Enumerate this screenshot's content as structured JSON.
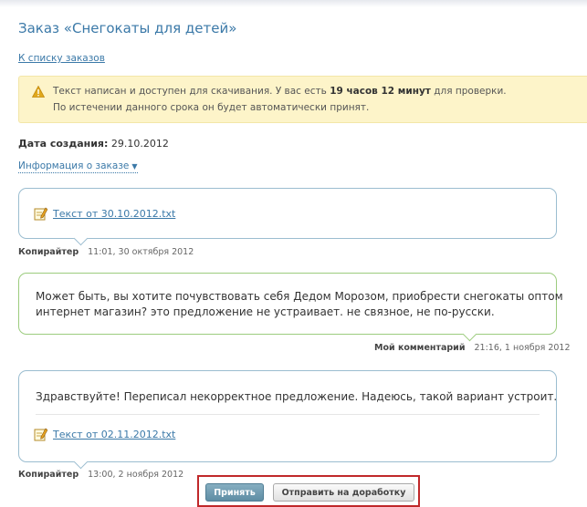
{
  "page": {
    "title": "Заказ «Снегокаты для детей»",
    "back_link": "К списку заказов"
  },
  "notice": {
    "line1_before": "Текст написан и доступен для скачивания. У вас есть",
    "line1_bold": "19 часов 12 минут",
    "line1_after": "для проверки.",
    "line2": "По истечении данного срока он будет автоматически принят.",
    "icon": "warning-triangle-icon"
  },
  "order": {
    "created_label": "Дата создания:",
    "created_value": "29.10.2012",
    "info_link": "Информация о заказе",
    "info_arrow": "▼"
  },
  "messages": [
    {
      "file_link": "Текст от 30.10.2012.txt",
      "author": "Копирайтер",
      "time": "11:01, 30 октября 2012"
    },
    {
      "text_line1": "Может быть, вы хотите почувствовать себя Дедом Морозом, приобрести снегокаты оптом",
      "text_line2": "интернет магазин? это предложение не устраивает. не связное, не по-русски.",
      "author": "Мой комментарий",
      "time": "21:16, 1 ноября 2012"
    },
    {
      "text": "Здравствуйте! Переписал некорректное предложение. Надеюсь, такой вариант устроит.",
      "file_link": "Текст от 02.11.2012.txt",
      "accept_label": "Принять",
      "rework_label": "Отправить на доработку",
      "author": "Копирайтер",
      "time": "13:00, 2 ноября 2012"
    }
  ],
  "colors": {
    "link": "#3b79a8",
    "notice_bg": "#fdf4c9",
    "copywriter_border": "#9bbdd0",
    "comment_border": "#9ccc7e",
    "highlight": "#c0282a"
  }
}
